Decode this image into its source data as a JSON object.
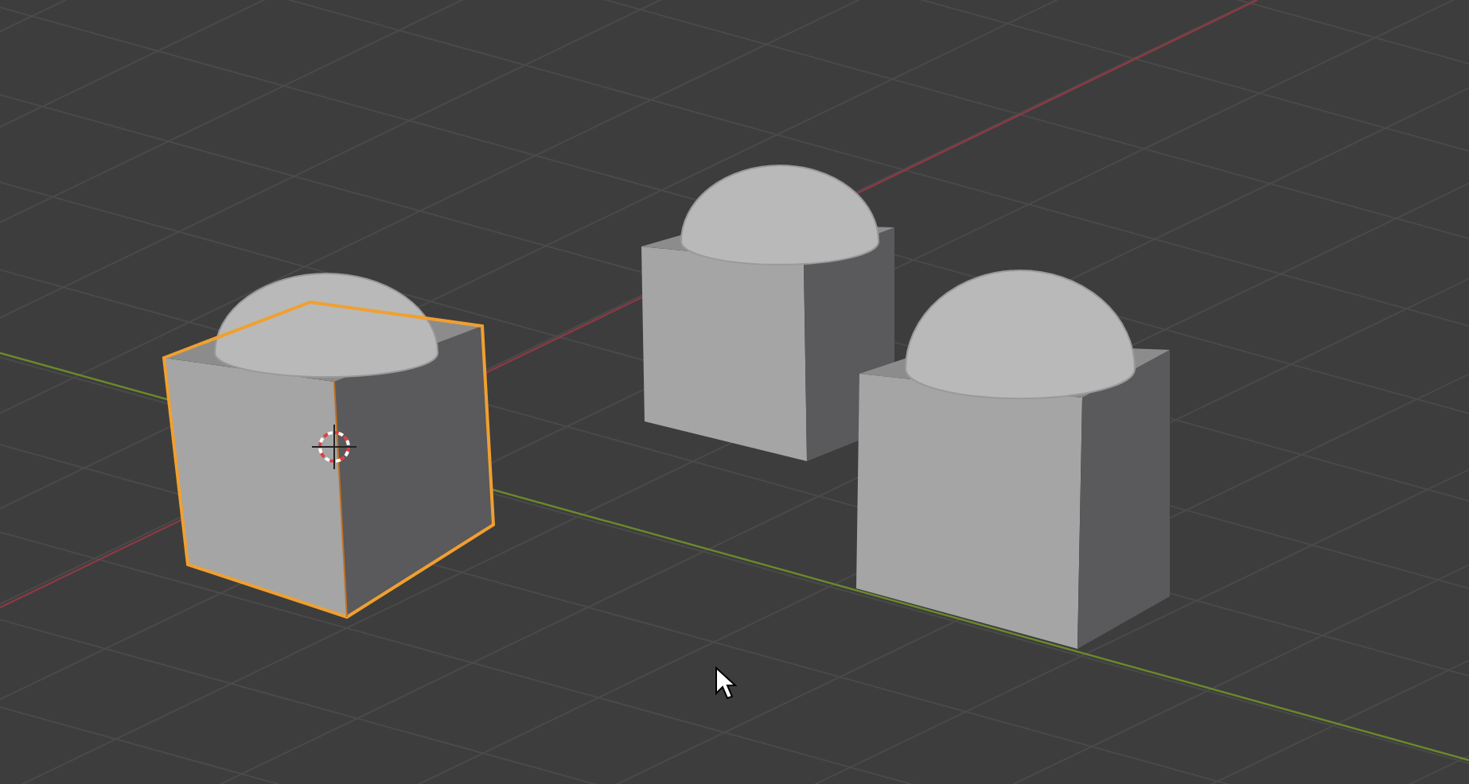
{
  "viewport": {
    "objects": [
      {
        "selected": true
      },
      {
        "selected": false
      },
      {
        "selected": false
      }
    ]
  }
}
